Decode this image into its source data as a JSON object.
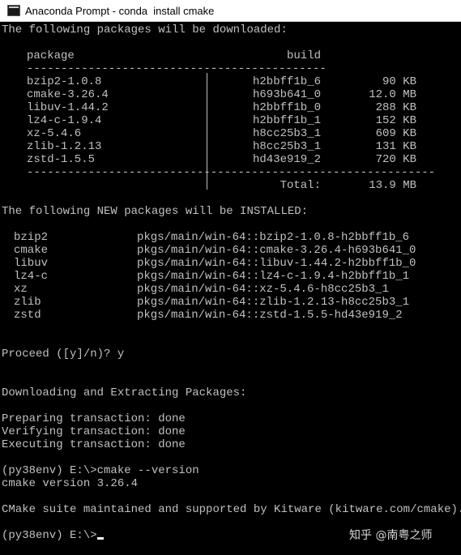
{
  "window": {
    "title": "Anaconda Prompt - conda  install cmake",
    "background": "#000000",
    "foreground": "#c0c0c0"
  },
  "download": {
    "intro": "The following packages will be downloaded:",
    "header_package": "package",
    "header_build": "build",
    "dashes_left": "----------------------------",
    "dashes_right": "-----------------",
    "rows": [
      {
        "package": "bzip2-1.0.8",
        "build": "h2bbff1b_6",
        "size": "90 KB"
      },
      {
        "package": "cmake-3.26.4",
        "build": "h693b641_0",
        "size": "12.0 MB"
      },
      {
        "package": "libuv-1.44.2",
        "build": "h2bbff1b_0",
        "size": "288 KB"
      },
      {
        "package": "lz4-c-1.9.4",
        "build": "h2bbff1b_1",
        "size": "152 KB"
      },
      {
        "package": "xz-5.4.6",
        "build": "h8cc25b3_1",
        "size": "609 KB"
      },
      {
        "package": "zlib-1.2.13",
        "build": "h8cc25b3_1",
        "size": "131 KB"
      },
      {
        "package": "zstd-1.5.5",
        "build": "hd43e919_2",
        "size": "720 KB"
      }
    ],
    "separator": "------------------------------------------------------------",
    "total_label": "Total:",
    "total_value": "13.9 MB"
  },
  "installed": {
    "intro": "The following NEW packages will be INSTALLED:",
    "rows": [
      {
        "name": "bzip2",
        "spec": "pkgs/main/win-64::bzip2-1.0.8-h2bbff1b_6"
      },
      {
        "name": "cmake",
        "spec": "pkgs/main/win-64::cmake-3.26.4-h693b641_0"
      },
      {
        "name": "libuv",
        "spec": "pkgs/main/win-64::libuv-1.44.2-h2bbff1b_0"
      },
      {
        "name": "lz4-c",
        "spec": "pkgs/main/win-64::lz4-c-1.9.4-h2bbff1b_1"
      },
      {
        "name": "xz",
        "spec": "pkgs/main/win-64::xz-5.4.6-h8cc25b3_1"
      },
      {
        "name": "zlib",
        "spec": "pkgs/main/win-64::zlib-1.2.13-h8cc25b3_1"
      },
      {
        "name": "zstd",
        "spec": "pkgs/main/win-64::zstd-1.5.5-hd43e919_2"
      }
    ]
  },
  "proceed": "Proceed ([y]/n)? y",
  "downloading": "Downloading and Extracting Packages:",
  "transaction": [
    "Preparing transaction: done",
    "Verifying transaction: done",
    "Executing transaction: done"
  ],
  "command": "(py38env) E:\\>cmake --version",
  "version_output": "cmake version 3.26.4",
  "maintained": "CMake suite maintained and supported by Kitware (kitware.com/cmake).",
  "prompt": "(py38env) E:\\>",
  "watermark": "知乎 @南粤之师"
}
